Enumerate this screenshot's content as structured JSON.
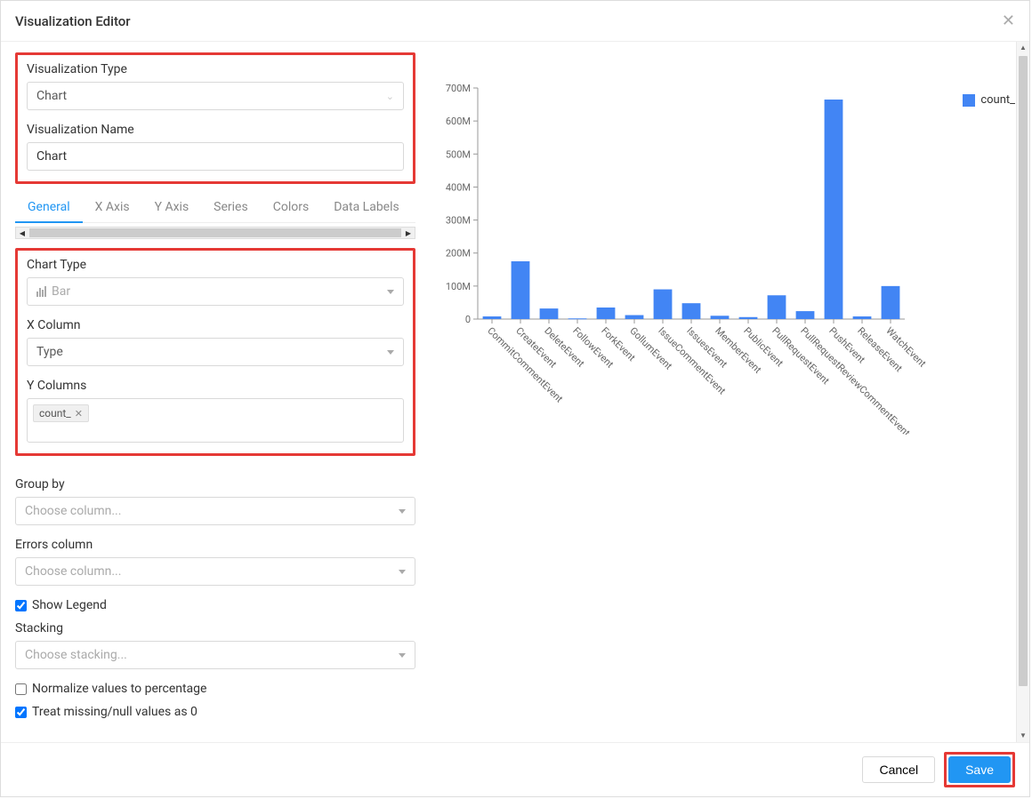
{
  "header": {
    "title": "Visualization Editor"
  },
  "form": {
    "viz_type_label": "Visualization Type",
    "viz_type_value": "Chart",
    "viz_name_label": "Visualization Name",
    "viz_name_value": "Chart",
    "chart_type_label": "Chart Type",
    "chart_type_value": "Bar",
    "x_col_label": "X Column",
    "x_col_value": "Type",
    "y_cols_label": "Y Columns",
    "y_cols_tag": "count_",
    "group_by_label": "Group by",
    "group_by_placeholder": "Choose column...",
    "errors_label": "Errors column",
    "errors_placeholder": "Choose column...",
    "show_legend_label": "Show Legend",
    "stacking_label": "Stacking",
    "stacking_placeholder": "Choose stacking...",
    "normalize_label": "Normalize values to percentage",
    "treat_missing_label": "Treat missing/null values as 0"
  },
  "tabs": [
    "General",
    "X Axis",
    "Y Axis",
    "Series",
    "Colors",
    "Data Labels"
  ],
  "footer": {
    "cancel": "Cancel",
    "save": "Save"
  },
  "legend_label": "count_",
  "chart_data": {
    "type": "bar",
    "ylabel": "",
    "xlabel": "",
    "title": "",
    "ylim": [
      0,
      700000000
    ],
    "ytick_labels": [
      "0",
      "100M",
      "200M",
      "300M",
      "400M",
      "500M",
      "600M",
      "700M"
    ],
    "categories": [
      "CommitCommentEvent",
      "CreateEvent",
      "DeleteEvent",
      "FollowEvent",
      "ForkEvent",
      "GollumEvent",
      "IssueCommentEvent",
      "IssuesEvent",
      "MemberEvent",
      "PublicEvent",
      "PullRequestEvent",
      "PullRequestReviewCommentEvent",
      "PushEvent",
      "ReleaseEvent",
      "WatchEvent"
    ],
    "series": [
      {
        "name": "count_",
        "values": [
          8000000,
          175000000,
          32000000,
          2000000,
          35000000,
          12000000,
          90000000,
          48000000,
          10000000,
          6000000,
          72000000,
          24000000,
          665000000,
          8000000,
          100000000
        ]
      }
    ]
  }
}
